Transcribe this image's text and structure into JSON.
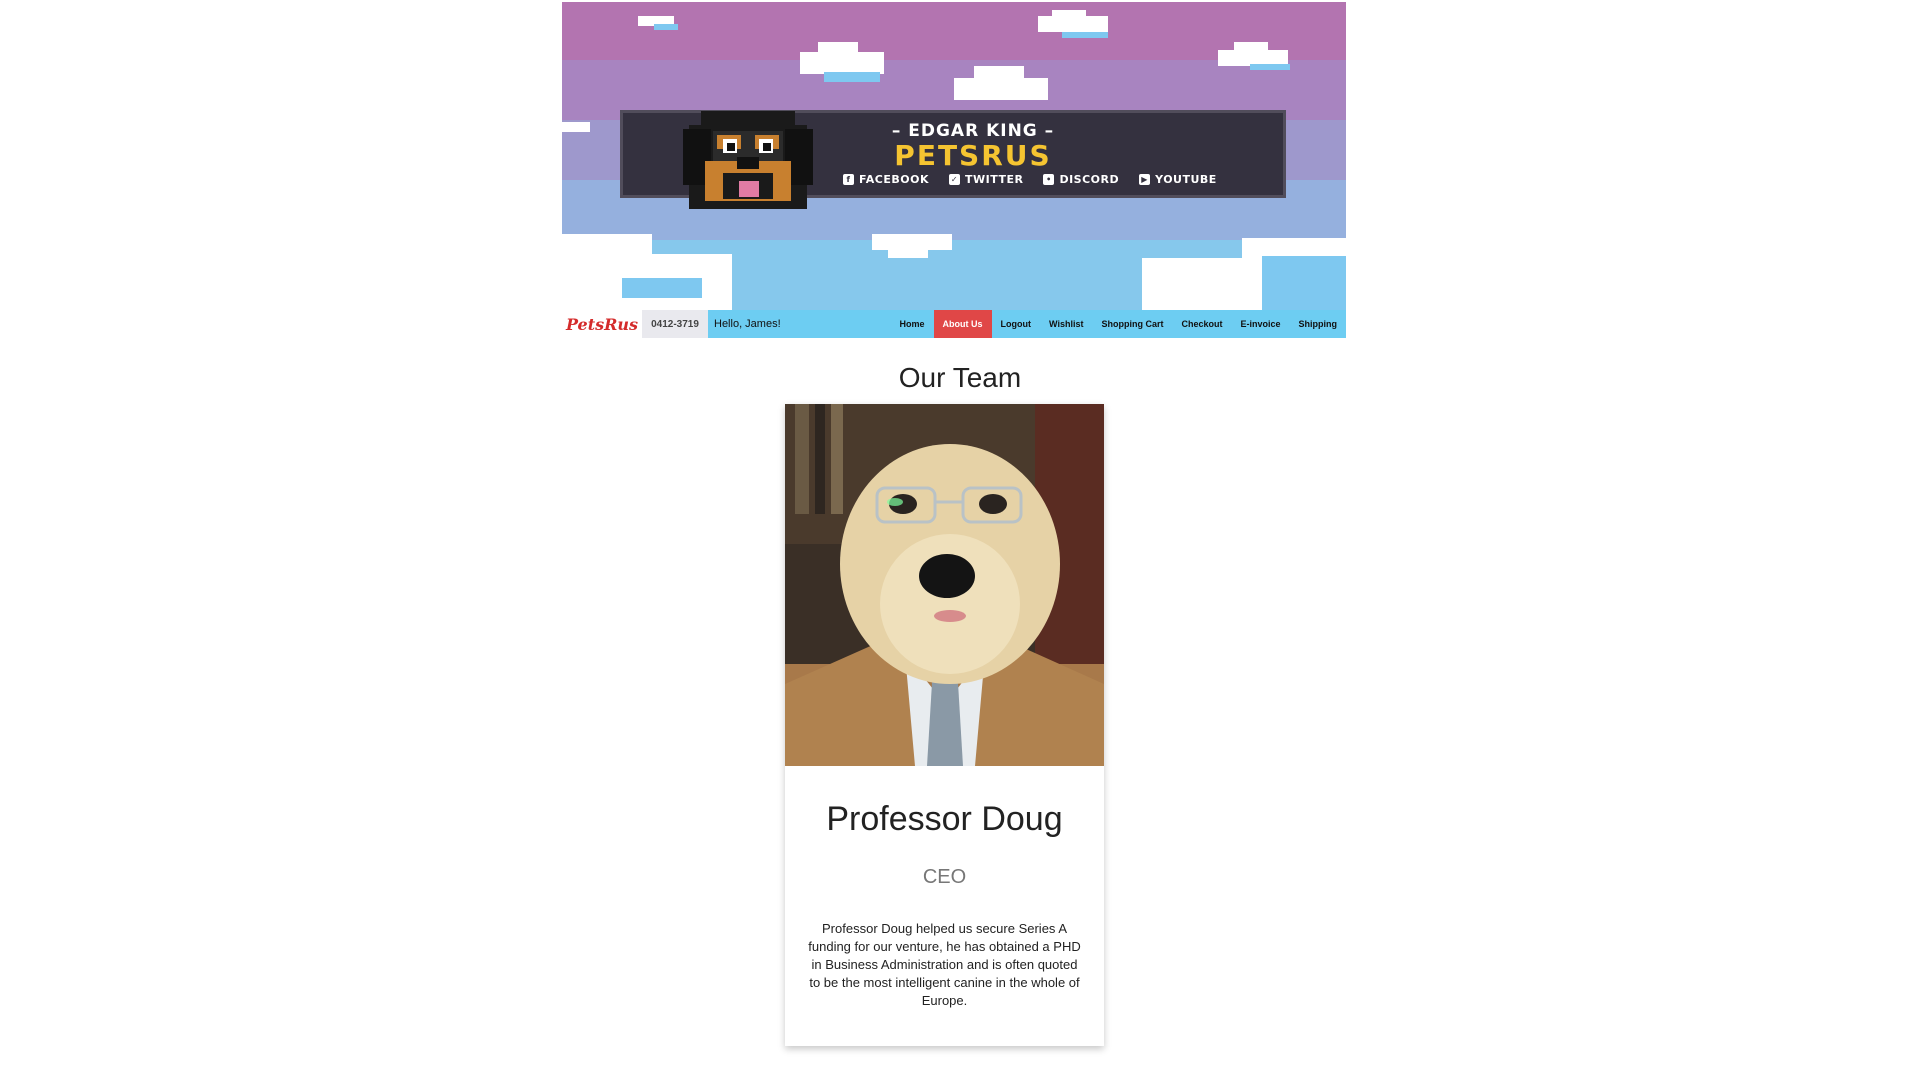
{
  "banner": {
    "brand_sub": "– EDGAR KING –",
    "brand_main": "PETSRUS",
    "socials": [
      {
        "label": "FACEBOOK",
        "icon": "facebook-icon"
      },
      {
        "label": "TWITTER",
        "icon": "twitter-icon"
      },
      {
        "label": "DISCORD",
        "icon": "discord-icon"
      },
      {
        "label": "YOUTUBE",
        "icon": "youtube-icon"
      }
    ]
  },
  "nav": {
    "logo_text": "PetsRus",
    "phone_text": "0412-3719",
    "greeting": "Hello, James!",
    "items": [
      {
        "label": "Home"
      },
      {
        "label": "About Us"
      },
      {
        "label": "Logout"
      },
      {
        "label": "Wishlist"
      },
      {
        "label": "Shopping Cart"
      },
      {
        "label": "Checkout"
      },
      {
        "label": "E-invoice"
      },
      {
        "label": "Shipping"
      }
    ],
    "active_index": 1,
    "colors": {
      "bar": "#6dcdf2",
      "active": "#e04747"
    }
  },
  "main": {
    "section_title": "Our Team",
    "card": {
      "name": "Professor Doug",
      "role": "CEO",
      "description": "Professor Doug helped us secure Series A funding for our venture, he has obtained a PHD in Business Administration and is often quoted to be the most intelligent canine in the whole of Europe."
    }
  }
}
